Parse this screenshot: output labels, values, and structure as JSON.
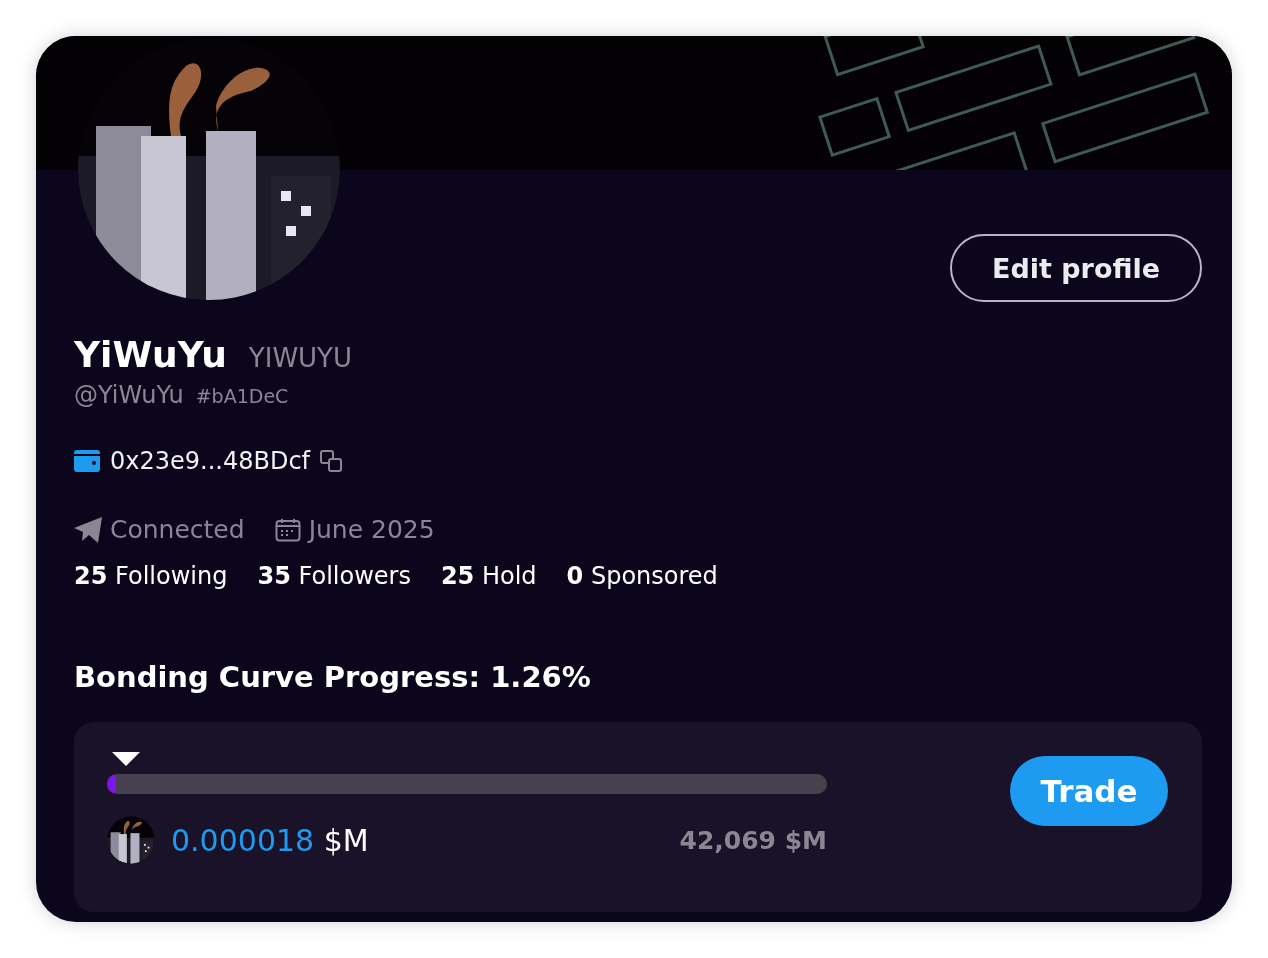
{
  "edit_button": "Edit profile",
  "profile": {
    "name": "YiWuYu",
    "ticker": "YIWUYU",
    "handle": "@YiWuYu",
    "tag": "#bA1DeC"
  },
  "wallet": {
    "address": "0x23e9...48BDcf"
  },
  "meta": [
    {
      "kind": "telegram",
      "label": "Connected"
    },
    {
      "kind": "calendar",
      "label": "June 2025"
    }
  ],
  "stats": [
    {
      "count": "25",
      "label": "Following"
    },
    {
      "count": "35",
      "label": "Followers"
    },
    {
      "count": "25",
      "label": "Hold"
    },
    {
      "count": "0",
      "label": "Sponsored"
    }
  ],
  "bonding": {
    "title": "Bonding Curve Progress: 1.26%",
    "level": 0.0126,
    "price": "0.000018",
    "unit": "$M",
    "target": "42,069 $M",
    "button": "Trade"
  }
}
